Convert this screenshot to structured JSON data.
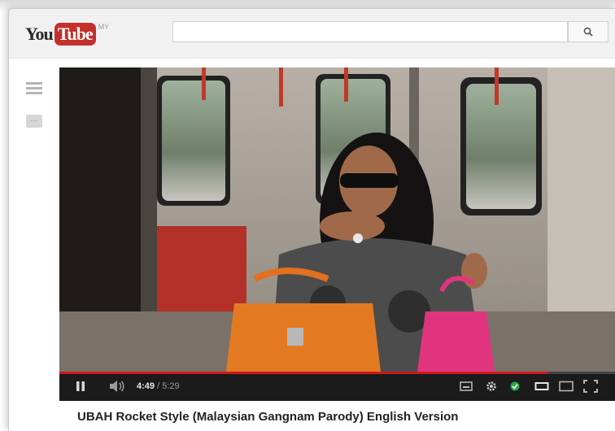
{
  "logo": {
    "you": "You",
    "tube": "Tube",
    "region": "MY"
  },
  "search": {
    "placeholder": "",
    "button_icon": "search-icon"
  },
  "guide": {
    "menu_icon": "guide-menu-icon",
    "more_icon": "more-icon"
  },
  "player": {
    "time_current": "4:49",
    "time_separator": " / ",
    "time_total": "5:29",
    "progress_fraction": 0.878,
    "accent_color": "#cc181e",
    "icons": [
      "play-pause-icon",
      "volume-icon",
      "captions-icon",
      "settings-icon",
      "hd-check-icon",
      "small-player-icon",
      "large-player-icon",
      "fullscreen-icon"
    ]
  },
  "video": {
    "title": "UBAH Rocket Style (Malaysian Gangnam Parody) English Version"
  }
}
